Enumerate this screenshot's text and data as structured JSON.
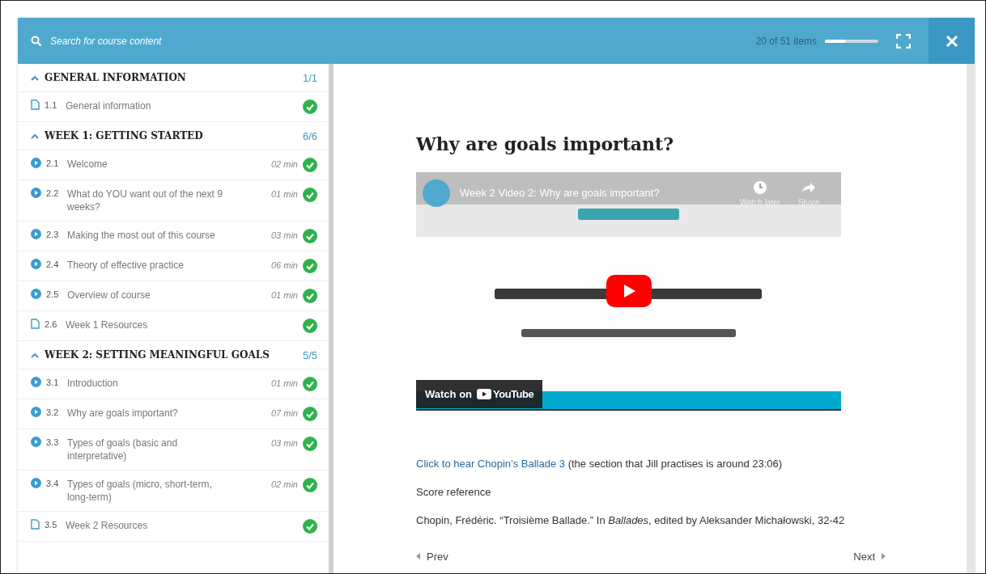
{
  "header": {
    "search": {
      "placeholder": "Search for course content"
    },
    "progress_text": "20 of 51 items",
    "progress": {
      "level": 0.39
    }
  },
  "sidebar": {
    "sections": [
      {
        "title": "GENERAL INFORMATION",
        "count": "1/1",
        "expanded": true,
        "items": [
          {
            "kind": "document",
            "number": "1.1",
            "title": "General information",
            "completed": true
          }
        ]
      },
      {
        "title": "WEEK 1: GETTING STARTED",
        "count": "6/6",
        "expanded": true,
        "items": [
          {
            "kind": "video",
            "number": "2.1",
            "title": "Welcome",
            "duration": "02 min",
            "completed": true
          },
          {
            "kind": "video",
            "number": "2.2",
            "title": "What do YOU want out of the next 9 weeks?",
            "duration": "01 min",
            "completed": true
          },
          {
            "kind": "video",
            "number": "2.3",
            "title": "Making the most out of this course",
            "duration": "03 min",
            "completed": true
          },
          {
            "kind": "video",
            "number": "2.4",
            "title": "Theory of effective practice",
            "duration": "06 min",
            "completed": true
          },
          {
            "kind": "video",
            "number": "2.5",
            "title": "Overview of course",
            "duration": "01 min",
            "completed": true
          },
          {
            "kind": "document",
            "number": "2.6",
            "title": "Week 1 Resources",
            "completed": true
          }
        ]
      },
      {
        "title": "WEEK 2: SETTING MEANINGFUL GOALS",
        "count": "5/5",
        "expanded": true,
        "items": [
          {
            "kind": "video",
            "number": "3.1",
            "title": "Introduction",
            "duration": "01 min",
            "completed": true
          },
          {
            "kind": "video",
            "number": "3.2",
            "title": "Why are goals important?",
            "duration": "07 min",
            "completed": true
          },
          {
            "kind": "video",
            "number": "3.3",
            "title": "Types of goals (basic and interpretative)",
            "duration": "03 min",
            "completed": true
          },
          {
            "kind": "video",
            "number": "3.4",
            "title": "Types of goals (micro, short-term, long-term)",
            "duration": "02 min",
            "completed": true
          },
          {
            "kind": "document",
            "number": "3.5",
            "title": "Week 2 Resources",
            "completed": true
          }
        ]
      }
    ]
  },
  "content": {
    "title": "Why are goals important?",
    "video": {
      "kind": "picture",
      "title": "Week 2 Video 2: Why are goals important?",
      "watch_later": "Watch later",
      "share": "Share",
      "watch_on": "Watch on",
      "brand": "YouTube"
    },
    "paragraphs": [
      {
        "kind": "link_line",
        "link": "Click to hear Chopin’s Ballade 3",
        "text": " (the section that Jill practises is around 23:06)"
      },
      {
        "kind": "text",
        "text": "Score reference"
      },
      {
        "kind": "text",
        "text": "Chopin, Frédéric. “Troisième Ballade.” In *Ballades*, edited by Aleksander Michałowski, 32-42"
      }
    ]
  },
  "footer": {
    "prev": "Prev",
    "next": "Next"
  }
}
